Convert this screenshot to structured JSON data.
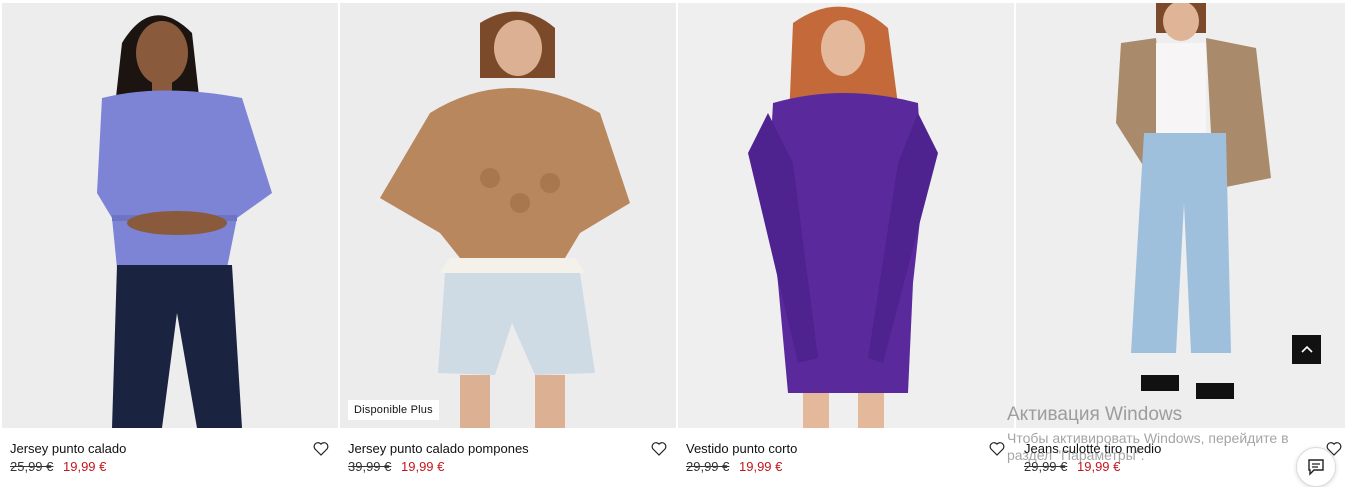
{
  "products": [
    {
      "name": "Jersey punto calado",
      "old_price": "25,99 €",
      "new_price": "19,99 €",
      "badge": ""
    },
    {
      "name": "Jersey punto calado pompones",
      "old_price": "39,99 €",
      "new_price": "19,99 €",
      "badge": "Disponible Plus"
    },
    {
      "name": "Vestido punto corto",
      "old_price": "29,99 €",
      "new_price": "19,99 €",
      "badge": ""
    },
    {
      "name": "Jeans culotte tiro medio",
      "old_price": "29,99 €",
      "new_price": "19,99 €",
      "badge": ""
    }
  ],
  "watermark": {
    "title": "Активация Windows",
    "line": "Чтобы активировать Windows, перейдите в раздел \"Параметры\"."
  },
  "colors": {
    "sale": "#c4161c",
    "photo_bg": "#ececec",
    "button_dark": "#111111"
  },
  "icons": {
    "favorite": "heart-icon",
    "scroll_top": "chevron-up-icon",
    "chat": "chat-icon"
  }
}
